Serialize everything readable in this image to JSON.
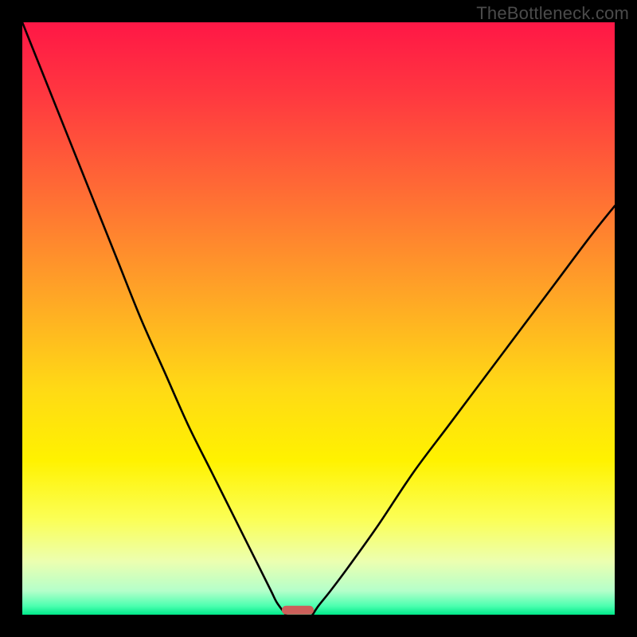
{
  "watermark": "TheBottleneck.com",
  "chart_data": {
    "type": "line",
    "title": "",
    "xlabel": "",
    "ylabel": "",
    "xlim": [
      0,
      100
    ],
    "ylim": [
      0,
      100
    ],
    "left_curve": {
      "x": [
        0,
        4,
        8,
        12,
        16,
        20,
        24,
        28,
        32,
        36,
        40,
        42,
        43,
        44.5
      ],
      "y": [
        100,
        90,
        80,
        70,
        60,
        50,
        41,
        32,
        24,
        16,
        8,
        4,
        2,
        0
      ]
    },
    "right_curve": {
      "x": [
        49,
        50,
        52,
        55,
        60,
        66,
        72,
        78,
        84,
        90,
        96,
        100
      ],
      "y": [
        0,
        1.5,
        4,
        8,
        15,
        24,
        32,
        40,
        48,
        56,
        64,
        69
      ]
    },
    "marker": {
      "x_start": 43.8,
      "x_end": 49.2,
      "y": 0.5
    },
    "gradient_stops": [
      {
        "pct": 0,
        "color": "#ff1746"
      },
      {
        "pct": 12,
        "color": "#ff3740"
      },
      {
        "pct": 28,
        "color": "#ff6a35"
      },
      {
        "pct": 45,
        "color": "#ffa227"
      },
      {
        "pct": 62,
        "color": "#ffda15"
      },
      {
        "pct": 74,
        "color": "#fff200"
      },
      {
        "pct": 84,
        "color": "#fbff57"
      },
      {
        "pct": 91,
        "color": "#ecffb0"
      },
      {
        "pct": 96,
        "color": "#b4ffca"
      },
      {
        "pct": 98.5,
        "color": "#4dffb0"
      },
      {
        "pct": 100,
        "color": "#00e98a"
      }
    ],
    "marker_color": "#cc5f5a",
    "curve_color": "#000000",
    "curve_width": 2.6
  }
}
